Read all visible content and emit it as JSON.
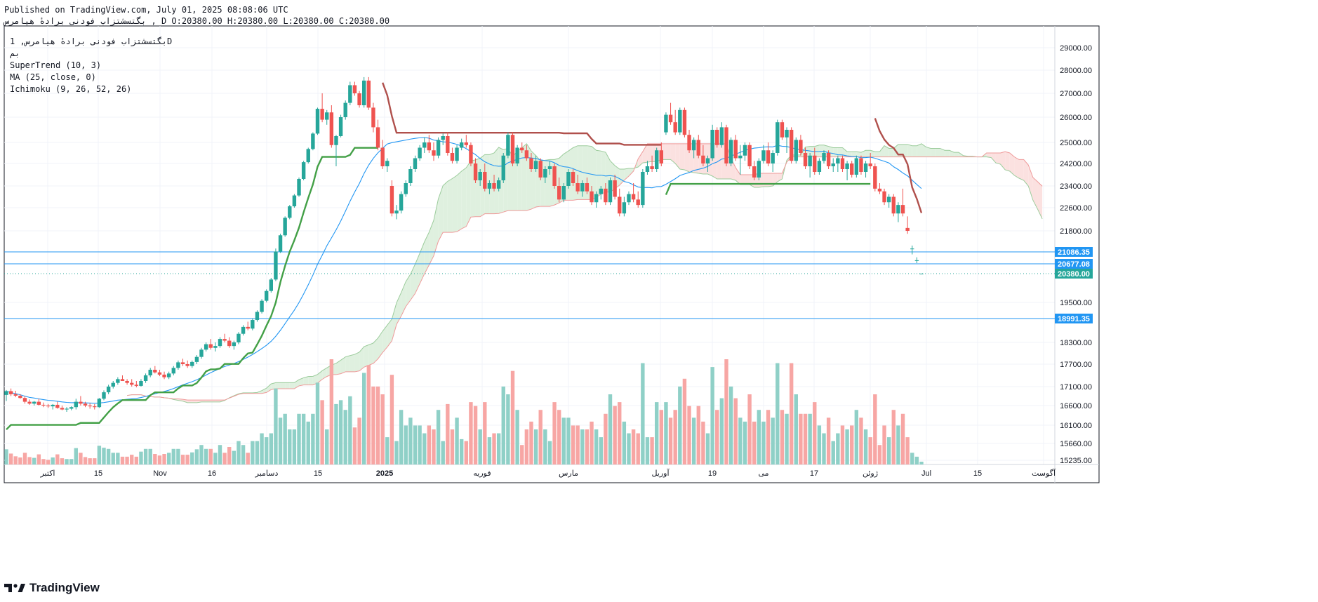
{
  "header": {
    "published": "Published on TradingView.com, July 01, 2025 08:08:06 UTC",
    "ohlc_line": "بگتسشتزاب فودنی برادهٔ هیامرس , D O:20380.00 H:20380.00 L:20380.00 C:20380.00"
  },
  "legend": {
    "symbol": "بگتسشتزاب فودنی برادهٔ هیامرس, 1D",
    "exchange": "بم",
    "indicators": [
      "SuperTrend (10, 3)",
      "MA (25, close, 0)",
      "Ichimoku (9, 26, 52, 26)"
    ]
  },
  "branding": {
    "logo_text": "TradingView"
  },
  "colors": {
    "up": "#26a69a",
    "down": "#ef5350",
    "vol_up": "#8fd0c7",
    "vol_down": "#f7a6a4",
    "supertrend_up": "#43a047",
    "supertrend_down": "#b0504c",
    "ma": "#2196f3",
    "hline": "#2196f3",
    "cloud_bull": "#dff0df",
    "cloud_bear": "#fbe1e0",
    "grid": "#f0f3fa",
    "axis_text": "#131722"
  },
  "chart_data": {
    "type": "candlestick",
    "timeframe": "1D",
    "x_tick_labels": [
      "اکتبر",
      "15",
      "Nov",
      "16",
      "دسامبر",
      "15",
      "2025",
      "فوریه",
      "مارس",
      "آوریل",
      "19",
      "می",
      "17",
      "ژوئن",
      "Jul",
      "15",
      "آگوست"
    ],
    "y_tick_labels": [
      "29000.00",
      "28000.00",
      "27000.00",
      "26000.00",
      "25000.00",
      "24200.00",
      "23400.00",
      "22600.00",
      "21800.00",
      "19500.00",
      "18300.00",
      "17700.00",
      "17100.00",
      "16600.00",
      "16100.00",
      "15660.00",
      "15235.00"
    ],
    "horizontal_lines": [
      21086.35,
      20677.08,
      18991.35
    ],
    "price_badges": [
      {
        "value": "21086.35",
        "color": "#2196f3"
      },
      {
        "value": "20677.08",
        "color": "#2196f3"
      },
      {
        "value": "20380.00",
        "color": "#26a69a"
      },
      {
        "value": "18991.35",
        "color": "#2196f3"
      }
    ],
    "last_close": 20380.0,
    "candles_ohlc": [
      [
        16880,
        17010,
        16720,
        16980
      ],
      [
        16980,
        17050,
        16850,
        16900
      ],
      [
        16900,
        16990,
        16820,
        16860
      ],
      [
        16860,
        16900,
        16780,
        16800
      ],
      [
        16800,
        16850,
        16650,
        16700
      ],
      [
        16700,
        16760,
        16620,
        16650
      ],
      [
        16650,
        16720,
        16600,
        16700
      ],
      [
        16700,
        16780,
        16600,
        16620
      ],
      [
        16620,
        16680,
        16560,
        16600
      ],
      [
        16600,
        16640,
        16540,
        16580
      ],
      [
        16580,
        16640,
        16500,
        16620
      ],
      [
        16620,
        16700,
        16520,
        16540
      ],
      [
        16540,
        16600,
        16480,
        16500
      ],
      [
        16500,
        16560,
        16440,
        16520
      ],
      [
        16520,
        16580,
        16480,
        16560
      ],
      [
        16560,
        16780,
        16500,
        16700
      ],
      [
        16700,
        16850,
        16600,
        16650
      ],
      [
        16650,
        16700,
        16560,
        16600
      ],
      [
        16600,
        16660,
        16520,
        16580
      ],
      [
        16580,
        16640,
        16500,
        16560
      ],
      [
        16560,
        16800,
        16540,
        16780
      ],
      [
        16780,
        17000,
        16740,
        16950
      ],
      [
        16950,
        17150,
        16900,
        17100
      ],
      [
        17100,
        17250,
        17050,
        17200
      ],
      [
        17200,
        17350,
        17150,
        17300
      ],
      [
        17300,
        17400,
        17250,
        17250
      ],
      [
        17250,
        17300,
        17150,
        17200
      ],
      [
        17200,
        17300,
        17100,
        17150
      ],
      [
        17150,
        17250,
        17080,
        17120
      ],
      [
        17120,
        17300,
        17100,
        17250
      ],
      [
        17250,
        17450,
        17200,
        17400
      ],
      [
        17400,
        17600,
        17350,
        17550
      ],
      [
        17550,
        17650,
        17450,
        17480
      ],
      [
        17480,
        17550,
        17380,
        17420
      ],
      [
        17420,
        17500,
        17300,
        17350
      ],
      [
        17350,
        17500,
        17300,
        17450
      ],
      [
        17450,
        17650,
        17400,
        17600
      ],
      [
        17600,
        17800,
        17550,
        17750
      ],
      [
        17750,
        17850,
        17650,
        17700
      ],
      [
        17700,
        17800,
        17600,
        17650
      ],
      [
        17650,
        17800,
        17600,
        17760
      ],
      [
        17760,
        17950,
        17700,
        17900
      ],
      [
        17900,
        18150,
        17850,
        18100
      ],
      [
        18100,
        18300,
        18050,
        18250
      ],
      [
        18250,
        18400,
        18100,
        18150
      ],
      [
        18150,
        18300,
        18050,
        18200
      ],
      [
        18200,
        18450,
        18150,
        18400
      ],
      [
        18400,
        18550,
        18300,
        18350
      ],
      [
        18350,
        18450,
        18150,
        18200
      ],
      [
        18200,
        18350,
        18100,
        18300
      ],
      [
        18300,
        18600,
        18250,
        18550
      ],
      [
        18550,
        18800,
        18500,
        18750
      ],
      [
        18750,
        18900,
        18650,
        18700
      ],
      [
        18700,
        19000,
        18650,
        18950
      ],
      [
        18950,
        19250,
        18900,
        19200
      ],
      [
        19200,
        19600,
        19150,
        19550
      ],
      [
        19550,
        19900,
        19500,
        19850
      ],
      [
        19850,
        20250,
        19800,
        20200
      ],
      [
        20200,
        21200,
        20150,
        21100
      ],
      [
        21100,
        21700,
        21050,
        21650
      ],
      [
        21650,
        22300,
        21600,
        22250
      ],
      [
        22250,
        22700,
        22200,
        22650
      ],
      [
        22650,
        23100,
        22600,
        23050
      ],
      [
        23050,
        23700,
        23000,
        23650
      ],
      [
        23650,
        24300,
        23600,
        24250
      ],
      [
        24250,
        24800,
        24200,
        24750
      ],
      [
        24750,
        25400,
        24700,
        25350
      ],
      [
        25350,
        26400,
        25300,
        26350
      ],
      [
        26350,
        27000,
        25800,
        25900
      ],
      [
        25900,
        26300,
        25700,
        26200
      ],
      [
        26200,
        26500,
        24800,
        24900
      ],
      [
        24900,
        25300,
        24100,
        25250
      ],
      [
        25250,
        26100,
        25200,
        26000
      ],
      [
        26000,
        26700,
        25900,
        26600
      ],
      [
        26600,
        27500,
        26500,
        27350
      ],
      [
        27350,
        27500,
        26900,
        27000
      ],
      [
        27000,
        27100,
        26400,
        26500
      ],
      [
        26500,
        27700,
        26400,
        27550
      ],
      [
        27550,
        27700,
        26300,
        26400
      ],
      [
        26400,
        26600,
        25400,
        25600
      ],
      [
        25600,
        25900,
        24700,
        24800
      ],
      [
        24800,
        25100,
        24000,
        24100
      ],
      [
        24100,
        24400,
        23900,
        24300
      ],
      [
        23400,
        23600,
        22300,
        22400
      ],
      [
        22400,
        22700,
        22200,
        22500
      ],
      [
        22500,
        23200,
        22400,
        23100
      ],
      [
        23100,
        23600,
        23000,
        23500
      ],
      [
        23500,
        24100,
        23400,
        24000
      ],
      [
        24000,
        24500,
        23900,
        24400
      ],
      [
        24400,
        24900,
        24300,
        24800
      ],
      [
        24800,
        25200,
        24600,
        25000
      ],
      [
        25000,
        25300,
        24600,
        24700
      ],
      [
        24700,
        25000,
        24300,
        24500
      ],
      [
        24500,
        25200,
        24400,
        25100
      ],
      [
        25100,
        25350,
        24900,
        25250
      ],
      [
        25250,
        25400,
        24500,
        24600
      ],
      [
        24600,
        24800,
        24200,
        24300
      ],
      [
        24300,
        24900,
        24200,
        24800
      ],
      [
        24800,
        25150,
        24700,
        25000
      ],
      [
        25000,
        25300,
        24800,
        24900
      ],
      [
        24900,
        25000,
        24100,
        24200
      ],
      [
        24200,
        24400,
        23500,
        23600
      ],
      [
        23600,
        24000,
        23400,
        23900
      ],
      [
        23900,
        24200,
        23200,
        23300
      ],
      [
        23300,
        23600,
        23100,
        23500
      ],
      [
        23500,
        23800,
        23200,
        23300
      ],
      [
        23300,
        23700,
        23200,
        23600
      ],
      [
        23600,
        24600,
        23500,
        24500
      ],
      [
        24500,
        25400,
        24400,
        25300
      ],
      [
        25300,
        25400,
        24100,
        24200
      ],
      [
        24200,
        24900,
        24100,
        24800
      ],
      [
        24800,
        25000,
        24600,
        24700
      ],
      [
        24700,
        24900,
        24300,
        24400
      ],
      [
        24400,
        24600,
        23900,
        24000
      ],
      [
        24000,
        24500,
        23900,
        24300
      ],
      [
        24300,
        24400,
        23600,
        23700
      ],
      [
        23700,
        24100,
        23500,
        24000
      ],
      [
        24000,
        24300,
        23800,
        24100
      ],
      [
        24100,
        24200,
        23300,
        23400
      ],
      [
        23400,
        23700,
        22800,
        22900
      ],
      [
        22900,
        23500,
        22800,
        23400
      ],
      [
        23400,
        24000,
        23300,
        23900
      ],
      [
        23900,
        24000,
        23400,
        23500
      ],
      [
        23500,
        23800,
        23100,
        23200
      ],
      [
        23200,
        23600,
        23000,
        23500
      ],
      [
        23500,
        23700,
        23100,
        23200
      ],
      [
        23200,
        23400,
        22700,
        22800
      ],
      [
        22800,
        23200,
        22600,
        23100
      ],
      [
        23100,
        23400,
        22900,
        23300
      ],
      [
        23300,
        23500,
        22700,
        22800
      ],
      [
        22800,
        23700,
        22700,
        23600
      ],
      [
        23600,
        23800,
        22900,
        23000
      ],
      [
        23000,
        23300,
        22300,
        22400
      ],
      [
        22400,
        23000,
        22300,
        22800
      ],
      [
        22800,
        23200,
        22700,
        23100
      ],
      [
        23100,
        23500,
        22800,
        22900
      ],
      [
        22900,
        23200,
        22600,
        22700
      ],
      [
        22700,
        24000,
        22600,
        23900
      ],
      [
        23900,
        24300,
        23800,
        24100
      ],
      [
        24100,
        24500,
        23900,
        24000
      ],
      [
        24000,
        24800,
        23900,
        24700
      ],
      [
        24700,
        25000,
        24100,
        24200
      ],
      [
        25400,
        26200,
        25300,
        26100
      ],
      [
        26100,
        26600,
        25700,
        25800
      ],
      [
        25800,
        26300,
        25300,
        25400
      ],
      [
        25400,
        26400,
        25300,
        26300
      ],
      [
        26300,
        26400,
        25200,
        25300
      ],
      [
        25300,
        25500,
        24600,
        24700
      ],
      [
        24700,
        25200,
        24400,
        25100
      ],
      [
        25100,
        25300,
        24400,
        24500
      ],
      [
        24500,
        24900,
        24100,
        24200
      ],
      [
        24200,
        24500,
        23900,
        24400
      ],
      [
        24400,
        25700,
        24300,
        25500
      ],
      [
        25500,
        25600,
        24800,
        24900
      ],
      [
        24900,
        25800,
        24800,
        25600
      ],
      [
        25600,
        25700,
        24100,
        24200
      ],
      [
        24200,
        25200,
        24100,
        25100
      ],
      [
        25100,
        25300,
        24300,
        24400
      ],
      [
        24400,
        24900,
        23800,
        24500
      ],
      [
        24500,
        25000,
        24300,
        24900
      ],
      [
        24900,
        25000,
        24000,
        24100
      ],
      [
        24100,
        24300,
        23600,
        23700
      ],
      [
        23700,
        24400,
        23600,
        24300
      ],
      [
        24300,
        24900,
        24200,
        24700
      ],
      [
        24700,
        25000,
        24100,
        24200
      ],
      [
        24200,
        24700,
        23900,
        24600
      ],
      [
        24600,
        25900,
        24500,
        25800
      ],
      [
        25800,
        25900,
        25100,
        25200
      ],
      [
        25200,
        25600,
        24600,
        25500
      ],
      [
        25500,
        25600,
        24200,
        24300
      ],
      [
        24300,
        25200,
        24200,
        25100
      ],
      [
        25100,
        25300,
        24500,
        24600
      ],
      [
        24600,
        24800,
        24000,
        24100
      ],
      [
        24100,
        24600,
        23700,
        24500
      ],
      [
        24500,
        24800,
        23800,
        23900
      ],
      [
        23900,
        24400,
        23800,
        24300
      ],
      [
        24300,
        24700,
        24200,
        24600
      ],
      [
        24600,
        24700,
        24000,
        24100
      ],
      [
        24100,
        24400,
        23900,
        24200
      ],
      [
        24200,
        24500,
        23900,
        24400
      ],
      [
        24400,
        24500,
        23900,
        24000
      ],
      [
        24000,
        24300,
        23600,
        24200
      ],
      [
        24200,
        24300,
        23700,
        23800
      ],
      [
        23800,
        24500,
        23700,
        24400
      ],
      [
        24400,
        24500,
        23800,
        23900
      ],
      [
        23900,
        24300,
        23700,
        24200
      ],
      [
        24200,
        24600,
        24000,
        24100
      ],
      [
        24100,
        24200,
        23200,
        23300
      ],
      [
        23300,
        23500,
        23100,
        23200
      ],
      [
        23200,
        23300,
        22700,
        22800
      ],
      [
        22800,
        23100,
        22600,
        23000
      ],
      [
        23000,
        23100,
        22300,
        22400
      ],
      [
        22400,
        22800,
        22100,
        22700
      ],
      [
        22700,
        23300,
        22300,
        22400
      ],
      [
        21900,
        22300,
        21700,
        21800
      ],
      [
        21200,
        21300,
        21000,
        21200
      ],
      [
        20800,
        20900,
        20700,
        20800
      ],
      [
        20380,
        20380,
        20380,
        20380
      ]
    ]
  }
}
